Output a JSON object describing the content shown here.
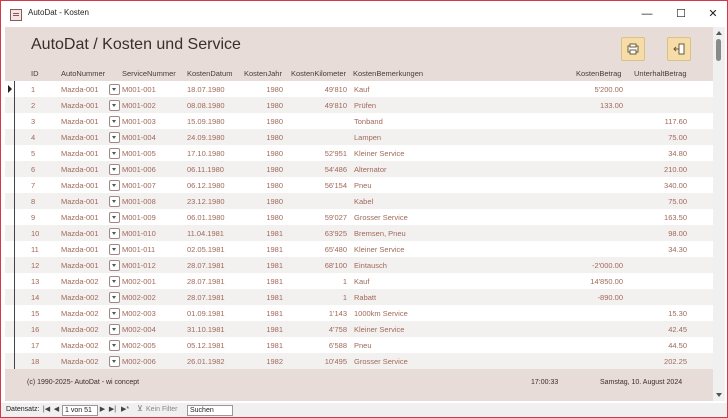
{
  "window": {
    "title": "AutoDat - Kosten",
    "minimize": "—",
    "maximize": "☐",
    "close": "✕"
  },
  "form": {
    "heading": "AutoDat / Kosten und Service"
  },
  "toolbar": {
    "print_icon": "print-icon",
    "exit_icon": "exit-icon"
  },
  "columns": {
    "id": "ID",
    "auto": "AutoNummer",
    "service": "ServiceNummer",
    "datum": "KostenDatum",
    "jahr": "KostenJahr",
    "km": "KostenKilometer",
    "bem": "KostenBemerkungen",
    "betrag": "KostenBetrag",
    "unterhalt": "UnterhaltBetrag"
  },
  "rows": [
    {
      "id": "1",
      "auto": "Mazda-001",
      "service": "M001-001",
      "datum": "18.07.1980",
      "jahr": "1980",
      "km": "49'810",
      "bem": "Kauf",
      "betrag": "5'200.00",
      "unterhalt": ""
    },
    {
      "id": "2",
      "auto": "Mazda-001",
      "service": "M001-002",
      "datum": "08.08.1980",
      "jahr": "1980",
      "km": "49'810",
      "bem": "Prüfen",
      "betrag": "133.00",
      "unterhalt": ""
    },
    {
      "id": "3",
      "auto": "Mazda-001",
      "service": "M001-003",
      "datum": "15.09.1980",
      "jahr": "1980",
      "km": "",
      "bem": "Tonband",
      "betrag": "",
      "unterhalt": "117.60"
    },
    {
      "id": "4",
      "auto": "Mazda-001",
      "service": "M001-004",
      "datum": "24.09.1980",
      "jahr": "1980",
      "km": "",
      "bem": "Lampen",
      "betrag": "",
      "unterhalt": "75.00"
    },
    {
      "id": "5",
      "auto": "Mazda-001",
      "service": "M001-005",
      "datum": "17.10.1980",
      "jahr": "1980",
      "km": "52'951",
      "bem": "Kleiner Service",
      "betrag": "",
      "unterhalt": "34.80"
    },
    {
      "id": "6",
      "auto": "Mazda-001",
      "service": "M001-006",
      "datum": "06.11.1980",
      "jahr": "1980",
      "km": "54'486",
      "bem": "Alternator",
      "betrag": "",
      "unterhalt": "210.00"
    },
    {
      "id": "7",
      "auto": "Mazda-001",
      "service": "M001-007",
      "datum": "06.12.1980",
      "jahr": "1980",
      "km": "56'154",
      "bem": "Pneu",
      "betrag": "",
      "unterhalt": "340.00"
    },
    {
      "id": "8",
      "auto": "Mazda-001",
      "service": "M001-008",
      "datum": "23.12.1980",
      "jahr": "1980",
      "km": "",
      "bem": "Kabel",
      "betrag": "",
      "unterhalt": "75.00"
    },
    {
      "id": "9",
      "auto": "Mazda-001",
      "service": "M001-009",
      "datum": "06.01.1980",
      "jahr": "1980",
      "km": "59'027",
      "bem": "Grosser Service",
      "betrag": "",
      "unterhalt": "163.50"
    },
    {
      "id": "10",
      "auto": "Mazda-001",
      "service": "M001-010",
      "datum": "11.04.1981",
      "jahr": "1981",
      "km": "63'925",
      "bem": "Bremsen, Pneu",
      "betrag": "",
      "unterhalt": "98.00"
    },
    {
      "id": "11",
      "auto": "Mazda-001",
      "service": "M001-011",
      "datum": "02.05.1981",
      "jahr": "1981",
      "km": "65'480",
      "bem": "Kleiner Service",
      "betrag": "",
      "unterhalt": "34.30"
    },
    {
      "id": "12",
      "auto": "Mazda-001",
      "service": "M001-012",
      "datum": "28.07.1981",
      "jahr": "1981",
      "km": "68'100",
      "bem": "Eintausch",
      "betrag": "-2'000.00",
      "unterhalt": ""
    },
    {
      "id": "13",
      "auto": "Mazda-002",
      "service": "M002-001",
      "datum": "28.07.1981",
      "jahr": "1981",
      "km": "1",
      "bem": "Kauf",
      "betrag": "14'850.00",
      "unterhalt": ""
    },
    {
      "id": "14",
      "auto": "Mazda-002",
      "service": "M002-002",
      "datum": "28.07.1981",
      "jahr": "1981",
      "km": "1",
      "bem": "Rabatt",
      "betrag": "-890.00",
      "unterhalt": ""
    },
    {
      "id": "15",
      "auto": "Mazda-002",
      "service": "M002-003",
      "datum": "01.09.1981",
      "jahr": "1981",
      "km": "1'143",
      "bem": "1000km Service",
      "betrag": "",
      "unterhalt": "15.30"
    },
    {
      "id": "16",
      "auto": "Mazda-002",
      "service": "M002-004",
      "datum": "31.10.1981",
      "jahr": "1981",
      "km": "4'758",
      "bem": "Kleiner Service",
      "betrag": "",
      "unterhalt": "42.45"
    },
    {
      "id": "17",
      "auto": "Mazda-002",
      "service": "M002-005",
      "datum": "05.12.1981",
      "jahr": "1981",
      "km": "6'588",
      "bem": "Pneu",
      "betrag": "",
      "unterhalt": "44.50"
    },
    {
      "id": "18",
      "auto": "Mazda-002",
      "service": "M002-006",
      "datum": "26.01.1982",
      "jahr": "1982",
      "km": "10'495",
      "bem": "Grosser Service",
      "betrag": "",
      "unterhalt": "202.25"
    }
  ],
  "footer": {
    "copyright": "(c) 1990-2025- AutoDat - wi concept",
    "time": "17:00:33",
    "date": "Samstag, 10. August 2024"
  },
  "navigation": {
    "label": "Datensatz:",
    "first": "|◀",
    "prev": "◀",
    "record": "1 von 51",
    "next": "▶",
    "last": "▶|",
    "new": "▶*",
    "filter": "Kein Filter",
    "search": "Suchen"
  }
}
